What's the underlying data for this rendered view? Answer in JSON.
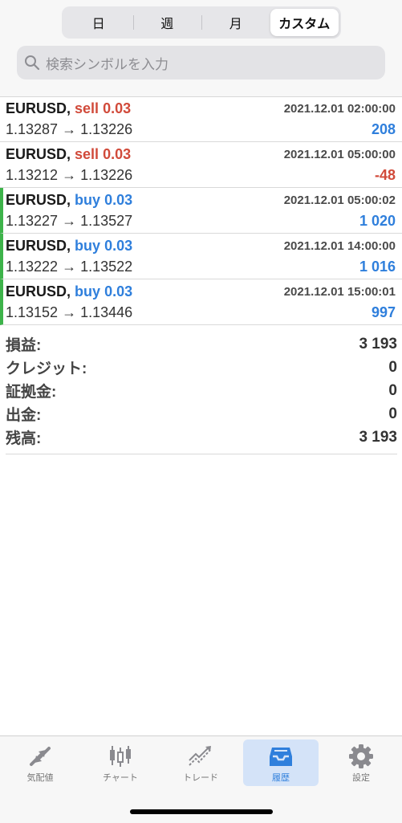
{
  "segments": [
    "日",
    "週",
    "月",
    "カスタム"
  ],
  "active_segment": "カスタム",
  "search": {
    "placeholder": "検索シンボルを入力"
  },
  "trades": [
    {
      "symbol": "EURUSD,",
      "side": "sell",
      "volume": "0.03",
      "time": "2021.12.01 02:00:00",
      "open": "1.13287",
      "close": "1.13226",
      "arrow": "→",
      "profit": "208"
    },
    {
      "symbol": "EURUSD,",
      "side": "sell",
      "volume": "0.03",
      "time": "2021.12.01 05:00:00",
      "open": "1.13212",
      "close": "1.13226",
      "arrow": "→",
      "profit": "-48"
    },
    {
      "symbol": "EURUSD,",
      "side": "buy",
      "volume": "0.03",
      "time": "2021.12.01 05:00:02",
      "open": "1.13227",
      "close": "1.13527",
      "arrow": "→",
      "profit": "1 020"
    },
    {
      "symbol": "EURUSD,",
      "side": "buy",
      "volume": "0.03",
      "time": "2021.12.01 14:00:00",
      "open": "1.13222",
      "close": "1.13522",
      "arrow": "→",
      "profit": "1 016"
    },
    {
      "symbol": "EURUSD,",
      "side": "buy",
      "volume": "0.03",
      "time": "2021.12.01 15:00:01",
      "open": "1.13152",
      "close": "1.13446",
      "arrow": "→",
      "profit": "997"
    }
  ],
  "summary": [
    {
      "label": "損益:",
      "value": "3 193"
    },
    {
      "label": "クレジット:",
      "value": "0"
    },
    {
      "label": "証拠金:",
      "value": "0"
    },
    {
      "label": "出金:",
      "value": "0"
    },
    {
      "label": "残高:",
      "value": "3 193"
    }
  ],
  "tabs": [
    {
      "label": "気配値",
      "icon": "quotes-icon"
    },
    {
      "label": "チャート",
      "icon": "chart-icon"
    },
    {
      "label": "トレード",
      "icon": "trade-icon"
    },
    {
      "label": "履歴",
      "icon": "history-icon"
    },
    {
      "label": "設定",
      "icon": "settings-icon"
    }
  ],
  "active_tab": "履歴",
  "colors": {
    "sell": "#d14a3a",
    "buy": "#2f7fdc",
    "buy_marker": "#3db34a",
    "active_tab_bg": "#d4e3f8"
  }
}
